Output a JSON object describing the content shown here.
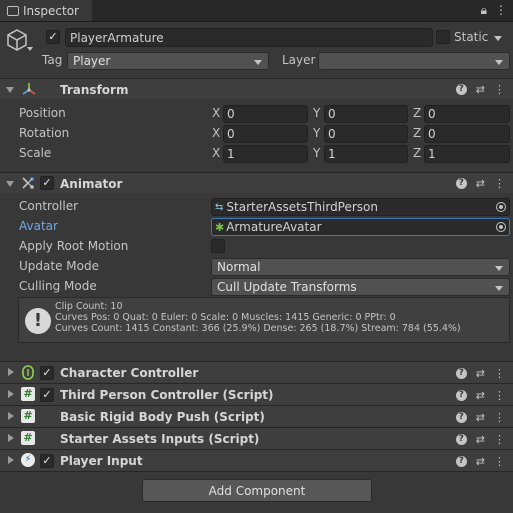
{
  "tab": {
    "label": "Inspector"
  },
  "header": {
    "object_name": "PlayerArmature",
    "active": true,
    "static_label": "Static",
    "tag_label": "Tag",
    "tag_value": "Player",
    "layer_label": "Layer",
    "layer_value": ""
  },
  "transform": {
    "title": "Transform",
    "rows": [
      {
        "label": "Position",
        "x": "0",
        "y": "0",
        "z": "0"
      },
      {
        "label": "Rotation",
        "x": "0",
        "y": "0",
        "z": "0"
      },
      {
        "label": "Scale",
        "x": "1",
        "y": "1",
        "z": "1"
      }
    ],
    "axes": {
      "x": "X",
      "y": "Y",
      "z": "Z"
    }
  },
  "animator": {
    "title": "Animator",
    "enabled": true,
    "controller_label": "Controller",
    "controller_value": "StarterAssetsThirdPerson",
    "avatar_label": "Avatar",
    "avatar_value": "ArmatureAvatar",
    "apply_root_motion_label": "Apply Root Motion",
    "update_mode_label": "Update Mode",
    "update_mode_value": "Normal",
    "culling_mode_label": "Culling Mode",
    "culling_mode_value": "Cull Update Transforms",
    "info": {
      "line1": "Clip Count: 10",
      "line2": "Curves Pos: 0 Quat: 0 Euler: 0 Scale: 0 Muscles: 1415 Generic: 0 PPtr: 0",
      "line3": "Curves Count: 1415 Constant: 366 (25.9%) Dense: 265 (18.7%) Stream: 784 (55.4%)"
    }
  },
  "components": [
    {
      "title": "Character Controller",
      "has_checkbox": true,
      "icon": "character-controller-icon"
    },
    {
      "title": "Third Person Controller (Script)",
      "has_checkbox": true,
      "icon": "script-icon"
    },
    {
      "title": "Basic Rigid Body Push (Script)",
      "has_checkbox": false,
      "icon": "script-icon"
    },
    {
      "title": "Starter Assets Inputs (Script)",
      "has_checkbox": false,
      "icon": "script-icon"
    },
    {
      "title": "Player Input",
      "has_checkbox": true,
      "icon": "player-input-icon"
    }
  ],
  "add_component_label": "Add Component",
  "colors": {
    "background": "#383838",
    "field": "#2a2a2a",
    "highlight_label": "#6ea8e6",
    "highlight_border": "#3a79bb"
  }
}
